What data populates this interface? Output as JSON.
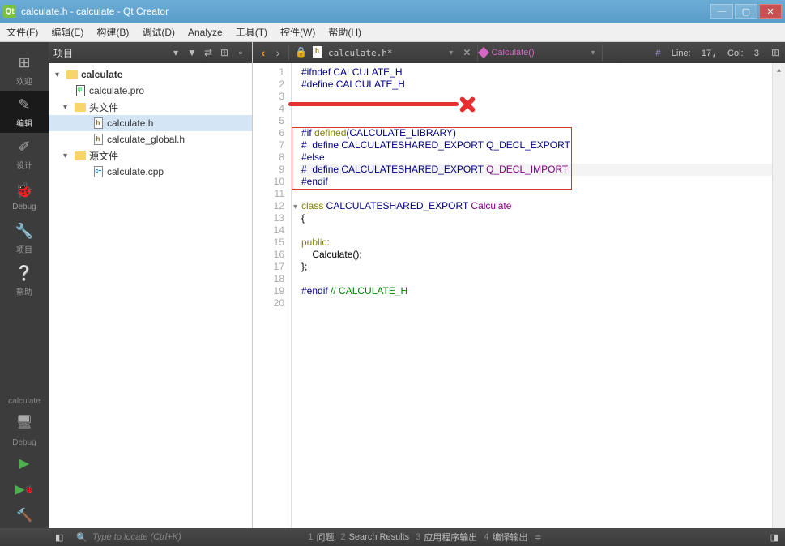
{
  "titlebar": {
    "text": "calculate.h - calculate - Qt Creator"
  },
  "menu": {
    "file": "文件(F)",
    "edit": "编辑(E)",
    "build": "构建(B)",
    "debug": "调试(D)",
    "analyze": "Analyze",
    "tools": "工具(T)",
    "widgets": "控件(W)",
    "help": "帮助(H)"
  },
  "sidebar": {
    "welcome": "欢迎",
    "edit": "编辑",
    "design": "设计",
    "debug": "Debug",
    "project": "项目",
    "help": "帮助",
    "calc_label": "calculate",
    "debug_label": "Debug"
  },
  "project_panel": {
    "title": "项目",
    "root": "calculate",
    "pro": "calculate.pro",
    "headers": "头文件",
    "h1": "calculate.h",
    "h2": "calculate_global.h",
    "sources": "源文件",
    "cpp1": "calculate.cpp"
  },
  "editor_tb": {
    "filename": "calculate.h*",
    "func": "Calculate()",
    "status_label": "Line:",
    "status_line": "17",
    "status_col_label": "Col:",
    "status_col": "3"
  },
  "code": {
    "l1a": "#ifndef ",
    "l1b": "CALCULATE_H",
    "l2a": "#define ",
    "l2b": "CALCULATE_H",
    "l6a": "#if ",
    "l6b": "defined",
    "l6c": "(CALCULATE_LIBRARY)",
    "l7a": "#  define ",
    "l7b": "CALCULATESHARED_EXPORT",
    "l7c": " Q_DECL_EXPORT",
    "l8": "#else",
    "l9a": "#  define ",
    "l9b": "CALCULATESHARED_EXPORT",
    "l9c": " Q_DECL_IMPORT",
    "l10": "#endif",
    "l12a": "class",
    "l12b": " CALCULATESHARED_EXPORT ",
    "l12c": "Calculate",
    "l13": "{",
    "l15a": "public",
    "l15b": ":",
    "l16": "    Calculate();",
    "l17": "};",
    "l19a": "#endif",
    "l19b": " // CALCULATE_H"
  },
  "footer": {
    "search_placeholder": "Type to locate (Ctrl+K)",
    "t1n": "1",
    "t1": "问题",
    "t2n": "2",
    "t2": "Search Results",
    "t3n": "3",
    "t3": "应用程序输出",
    "t4n": "4",
    "t4": "编译输出"
  }
}
